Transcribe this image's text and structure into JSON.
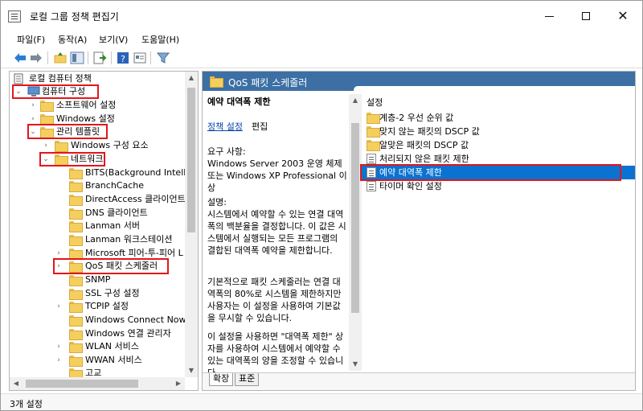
{
  "window": {
    "title": "로컬 그룹 정책 편집기"
  },
  "menu": [
    "파일(F)",
    "동작(A)",
    "보기(V)",
    "도움말(H)"
  ],
  "tree": {
    "root": "로컬 컴퓨터 정책",
    "items": [
      {
        "label": "컴퓨터 구성",
        "expander": "⌄",
        "highlight": true
      },
      {
        "label": "소프트웨어 설정",
        "expander": "›"
      },
      {
        "label": "Windows 설정",
        "expander": "›"
      },
      {
        "label": "관리 템플릿",
        "expander": "⌄",
        "highlight": true
      },
      {
        "label": "Windows 구성 요소",
        "expander": "›"
      },
      {
        "label": "네트워크",
        "expander": "⌄",
        "highlight": true
      },
      {
        "label": "BITS(Background Intellige",
        "expander": ""
      },
      {
        "label": "BranchCache",
        "expander": ""
      },
      {
        "label": "DirectAccess 클라이언트",
        "expander": ""
      },
      {
        "label": "DNS 클라이언트",
        "expander": ""
      },
      {
        "label": "Lanman 서버",
        "expander": ""
      },
      {
        "label": "Lanman 워크스테이션",
        "expander": ""
      },
      {
        "label": "Microsoft 피어-투-피어 L",
        "expander": "›"
      },
      {
        "label": "QoS 패킷 스케줄러",
        "expander": "›",
        "highlight": true
      },
      {
        "label": "SNMP",
        "expander": ""
      },
      {
        "label": "SSL 구성 설정",
        "expander": ""
      },
      {
        "label": "TCPIP 설정",
        "expander": "›"
      },
      {
        "label": "Windows Connect Now",
        "expander": ""
      },
      {
        "label": "Windows 연결 관리자",
        "expander": ""
      },
      {
        "label": "WLAN 서비스",
        "expander": "›"
      },
      {
        "label": "WWAN 서비스",
        "expander": "›"
      },
      {
        "label": "고교",
        "expander": ""
      }
    ]
  },
  "right_pane": {
    "header_title": "QoS 패킷 스케줄러",
    "description": {
      "title": "예약 대역폭 제한",
      "policy_link": "정책 설정",
      "edit_text": "편집",
      "requirements": "요구 사항:\nWindows Server 2003 운영 체제 또는 Windows XP Professional 이상",
      "explanation": "설명:\n시스템에서 예약할 수 있는 연결 대역폭의 백분율을 결정합니다. 이 값은 시스템에서 실행되는 모든 프로그램의 결합된 대역폭 예약을 제한합니다.",
      "paragraph2": "기본적으로 패킷 스케줄러는 연결 대역폭의 80%로 시스템을 제한하지만 사용자는 이 설정을 사용하여 기본값을 무시할 수 있습니다.",
      "paragraph3": "이 설정을 사용하면 \"대역폭 제한\" 상자를 사용하여 시스템에서 예약할 수 있는 대역폭의 양을 조정할 수 있습니다."
    },
    "list_header": "설정",
    "items": [
      {
        "label": "계층-2 우선 순위 값",
        "kind": "folder"
      },
      {
        "label": "맞지 않는 패킷의 DSCP 값",
        "kind": "folder"
      },
      {
        "label": "알맞은 패킷의 DSCP 값",
        "kind": "folder"
      },
      {
        "label": "처리되지 않은 패킷 제한",
        "kind": "setting"
      },
      {
        "label": "예약 대역폭 제한",
        "kind": "setting",
        "selected": true,
        "highlight": true
      },
      {
        "label": "타이머 확인 설정",
        "kind": "setting"
      }
    ],
    "tabs": [
      "확장",
      "표준"
    ]
  },
  "status": "3개 설정",
  "colors": {
    "highlight_red": "#e3161b",
    "header_blue": "#3c6fa4",
    "selection_blue": "#0a72d0",
    "folder_yellow": "#f5cf5e"
  }
}
